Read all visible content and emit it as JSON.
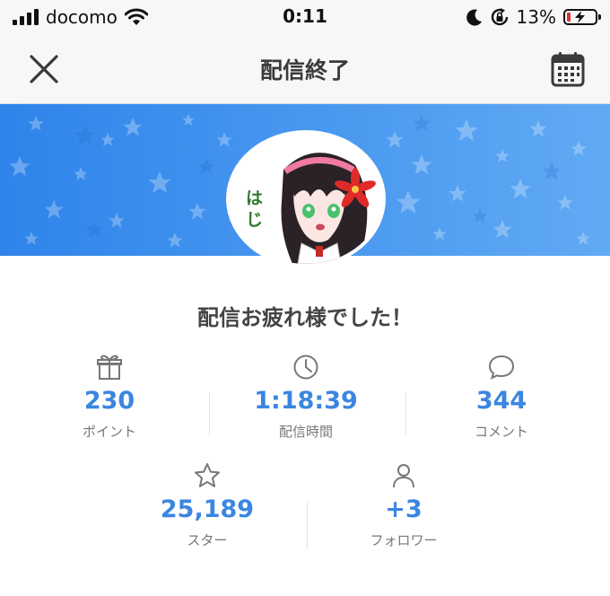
{
  "status_bar": {
    "carrier": "docomo",
    "time": "0:11",
    "battery_percent": "13%",
    "battery_level": 0.13
  },
  "nav": {
    "title": "配信終了",
    "close_icon": "close-icon",
    "calendar_icon": "calendar-icon"
  },
  "profile": {
    "avatar_text": "はじ"
  },
  "message": "配信お疲れ様でした！",
  "stats": {
    "points": {
      "value": "230",
      "label": "ポイント",
      "icon": "gift-icon"
    },
    "duration": {
      "value": "1:18:39",
      "label": "配信時間",
      "icon": "clock-icon"
    },
    "comments": {
      "value": "344",
      "label": "コメント",
      "icon": "comment-icon"
    },
    "stars": {
      "value": "25,189",
      "label": "スター",
      "icon": "star-icon"
    },
    "followers": {
      "value": "+3",
      "label": "フォロワー",
      "icon": "person-icon"
    }
  },
  "colors": {
    "accent": "#3b86e0",
    "banner_start": "#2f84ea",
    "banner_end": "#61aaf4",
    "battery_low": "#e03131"
  }
}
